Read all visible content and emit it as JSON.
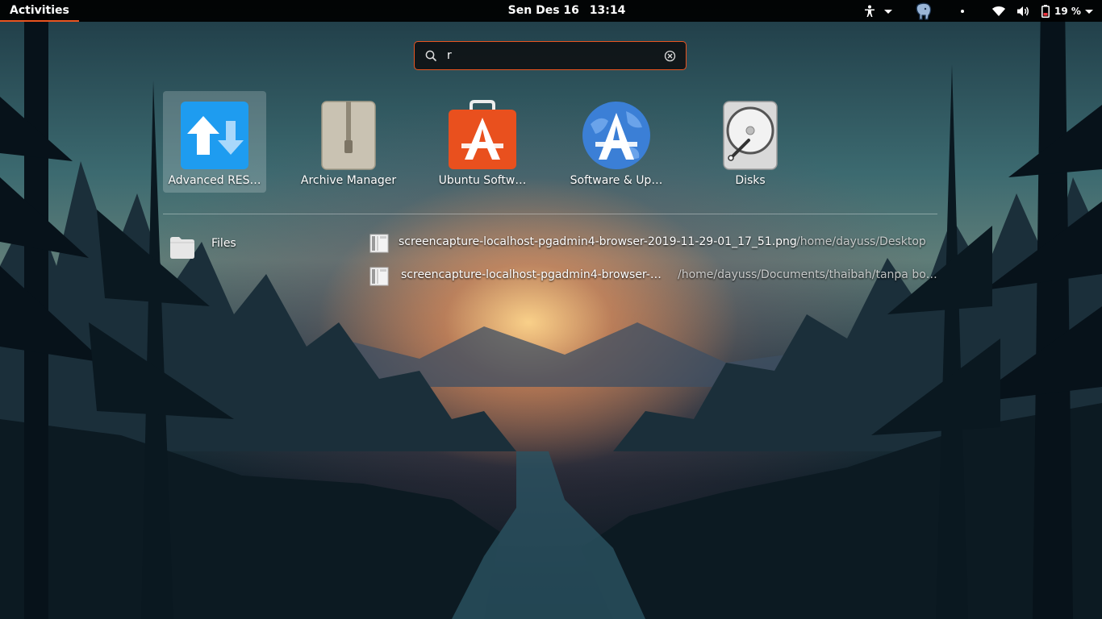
{
  "topbar": {
    "activities": "Activities",
    "clock_day": "Sen Des 16",
    "clock_time": "13:14",
    "battery_percent": "19 %",
    "tray_icons": [
      "accessibility-icon",
      "elephant-icon",
      "dot-icon",
      "wifi-icon",
      "volume-icon",
      "battery-icon",
      "power-menu-icon"
    ]
  },
  "search": {
    "value": "r",
    "search_icon": "search-icon",
    "clear_icon": "clear-icon"
  },
  "apps": [
    {
      "label": "Advanced RES…",
      "icon": "transfer-arrows-icon",
      "selected": true
    },
    {
      "label": "Archive Manager",
      "icon": "archive-zipper-icon",
      "selected": false
    },
    {
      "label": "Ubuntu Softw…",
      "icon": "shopping-bag-icon",
      "selected": false
    },
    {
      "label": "Software & Up…",
      "icon": "globe-update-icon",
      "selected": false
    },
    {
      "label": "Disks",
      "icon": "disk-icon",
      "selected": false
    }
  ],
  "results": {
    "provider": {
      "label": "Files",
      "icon": "folder-icon"
    },
    "items": [
      {
        "name": "screencapture-localhost-pgadmin4-browser-2019-11-29-01_17_51.png",
        "path": "/home/dayuss/Desktop"
      },
      {
        "name": "screencapture-localhost-pgadmin4-browser-…",
        "path": "/home/dayuss/Documents/thaibah/tanpa bo…"
      }
    ]
  },
  "colors": {
    "accent": "#e95420",
    "topbar": "#000000",
    "selected_tile": "#ffffff33"
  }
}
